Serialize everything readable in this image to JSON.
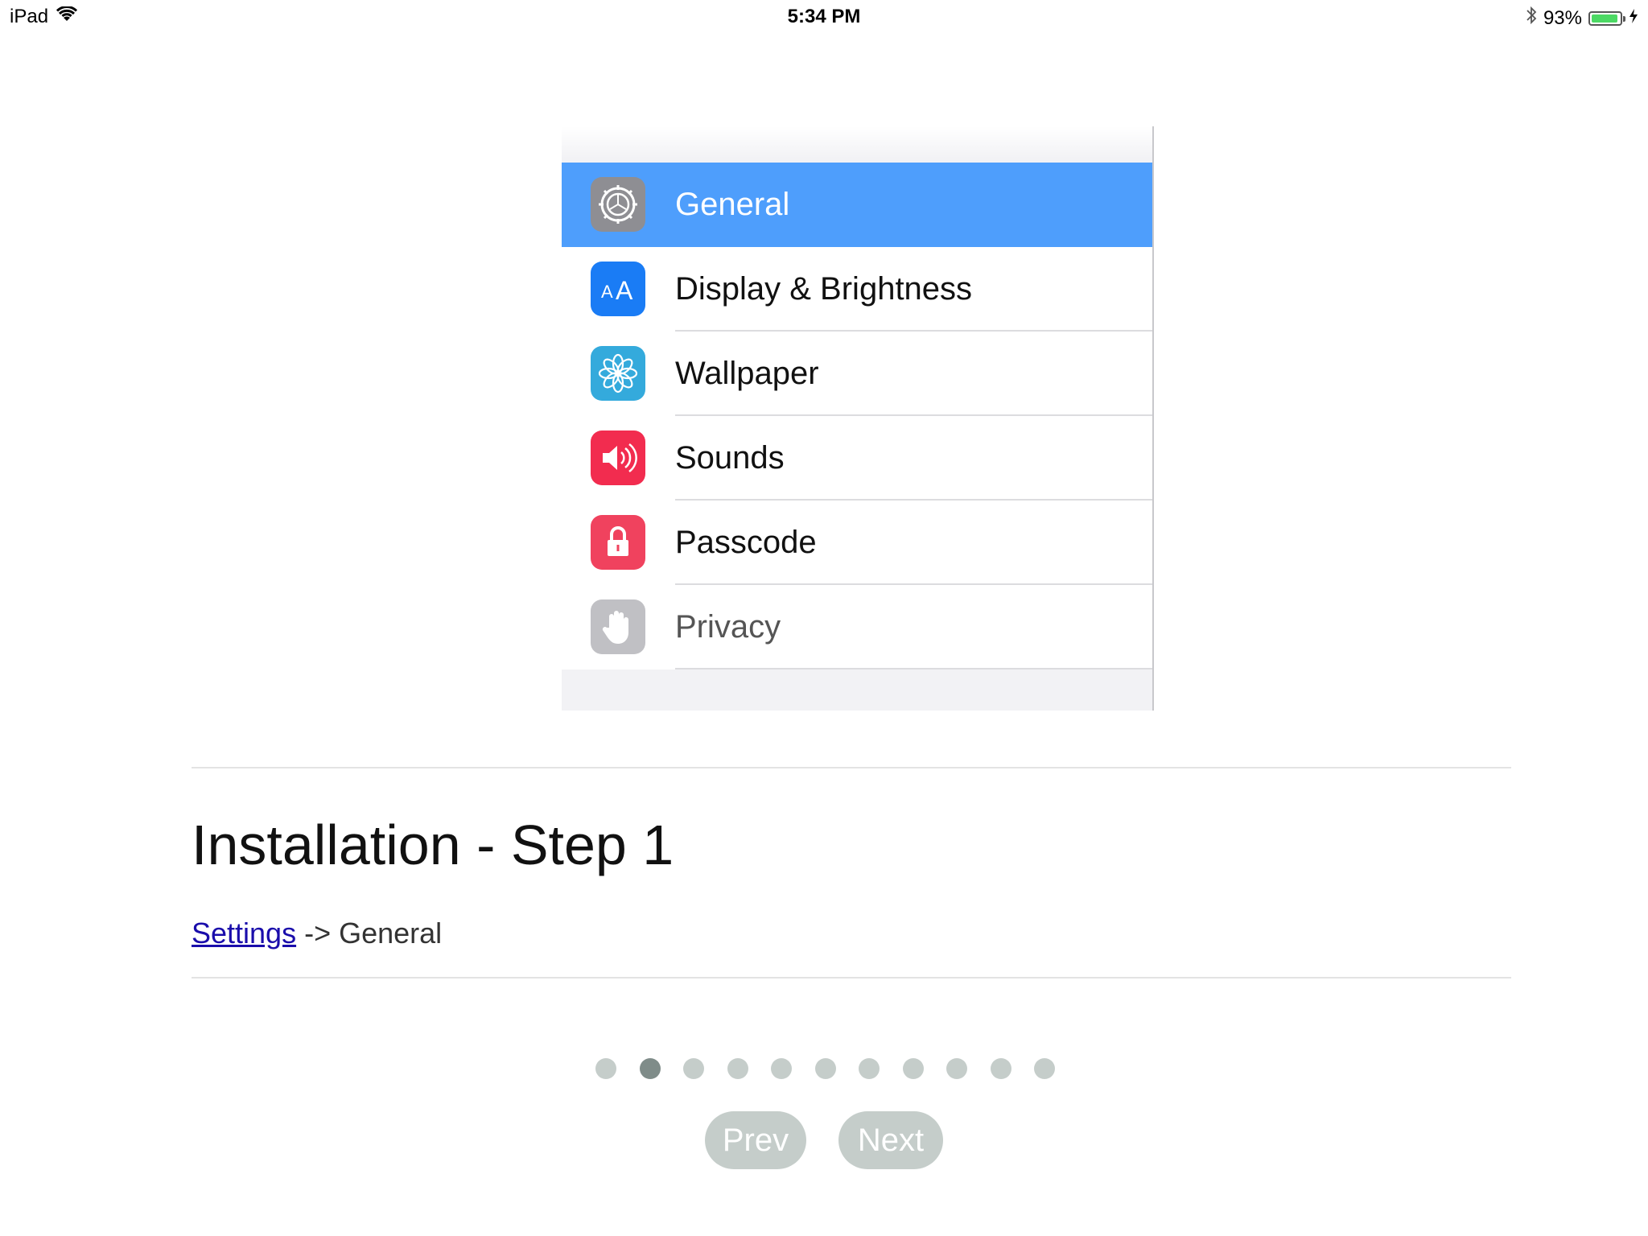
{
  "status_bar": {
    "device": "iPad",
    "time": "5:34 PM",
    "battery_text": "93%",
    "battery_level": 0.93,
    "battery_color": "#4cd964"
  },
  "settings_list": {
    "selected_color": "#4e9efc",
    "items": [
      {
        "label": "General",
        "icon": "gear-icon",
        "icon_color": "#8e8e93",
        "selected": true
      },
      {
        "label": "Display & Brightness",
        "icon": "display-brightness-icon",
        "icon_color": "#1a7cf5",
        "selected": false
      },
      {
        "label": "Wallpaper",
        "icon": "wallpaper-flower-icon",
        "icon_color": "#34aadc",
        "selected": false
      },
      {
        "label": "Sounds",
        "icon": "speaker-icon",
        "icon_color": "#f22c4f",
        "selected": false
      },
      {
        "label": "Passcode",
        "icon": "lock-icon",
        "icon_color": "#f0425e",
        "selected": false
      },
      {
        "label": "Privacy",
        "icon": "hand-icon",
        "icon_color": "#c0c0c4",
        "selected": false
      }
    ]
  },
  "step": {
    "title": "Installation - Step 1",
    "breadcrumb_link": "Settings",
    "breadcrumb_rest": " -> General"
  },
  "pagination": {
    "total": 11,
    "current": 2,
    "active_color": "#7f8c89",
    "inactive_color": "#c5cdca"
  },
  "buttons": {
    "prev_label": "Prev",
    "next_label": "Next"
  }
}
